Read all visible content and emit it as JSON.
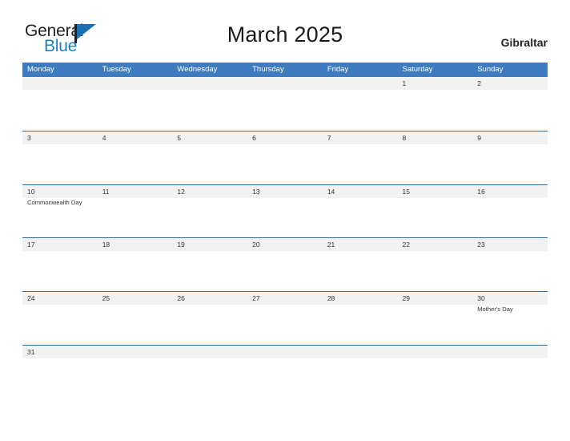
{
  "brand": {
    "name_part1": "General",
    "name_part2": "Blue",
    "color_primary": "#1a6fb5",
    "color_text": "#231f20"
  },
  "header": {
    "title": "March 2025",
    "country": "Gibraltar"
  },
  "calendar": {
    "header_bg": "#3e7cbf",
    "row_divider_color": "#2e6da4",
    "date_strip_bg": "#f2f2f2",
    "weekdays": [
      "Monday",
      "Tuesday",
      "Wednesday",
      "Thursday",
      "Friday",
      "Saturday",
      "Sunday"
    ],
    "weeks": [
      {
        "days": [
          {
            "date": "",
            "event": ""
          },
          {
            "date": "",
            "event": ""
          },
          {
            "date": "",
            "event": ""
          },
          {
            "date": "",
            "event": ""
          },
          {
            "date": "",
            "event": ""
          },
          {
            "date": "1",
            "event": ""
          },
          {
            "date": "2",
            "event": ""
          }
        ]
      },
      {
        "days": [
          {
            "date": "3",
            "event": ""
          },
          {
            "date": "4",
            "event": ""
          },
          {
            "date": "5",
            "event": ""
          },
          {
            "date": "6",
            "event": ""
          },
          {
            "date": "7",
            "event": ""
          },
          {
            "date": "8",
            "event": ""
          },
          {
            "date": "9",
            "event": ""
          }
        ]
      },
      {
        "days": [
          {
            "date": "10",
            "event": "Commonwealth Day"
          },
          {
            "date": "11",
            "event": ""
          },
          {
            "date": "12",
            "event": ""
          },
          {
            "date": "13",
            "event": ""
          },
          {
            "date": "14",
            "event": ""
          },
          {
            "date": "15",
            "event": ""
          },
          {
            "date": "16",
            "event": ""
          }
        ]
      },
      {
        "days": [
          {
            "date": "17",
            "event": ""
          },
          {
            "date": "18",
            "event": ""
          },
          {
            "date": "19",
            "event": ""
          },
          {
            "date": "20",
            "event": ""
          },
          {
            "date": "21",
            "event": ""
          },
          {
            "date": "22",
            "event": ""
          },
          {
            "date": "23",
            "event": ""
          }
        ]
      },
      {
        "days": [
          {
            "date": "24",
            "event": ""
          },
          {
            "date": "25",
            "event": ""
          },
          {
            "date": "26",
            "event": ""
          },
          {
            "date": "27",
            "event": ""
          },
          {
            "date": "28",
            "event": ""
          },
          {
            "date": "29",
            "event": ""
          },
          {
            "date": "30",
            "event": "Mother's Day"
          }
        ]
      },
      {
        "days": [
          {
            "date": "31",
            "event": ""
          },
          {
            "date": "",
            "event": ""
          },
          {
            "date": "",
            "event": ""
          },
          {
            "date": "",
            "event": ""
          },
          {
            "date": "",
            "event": ""
          },
          {
            "date": "",
            "event": ""
          },
          {
            "date": "",
            "event": ""
          }
        ]
      }
    ]
  }
}
